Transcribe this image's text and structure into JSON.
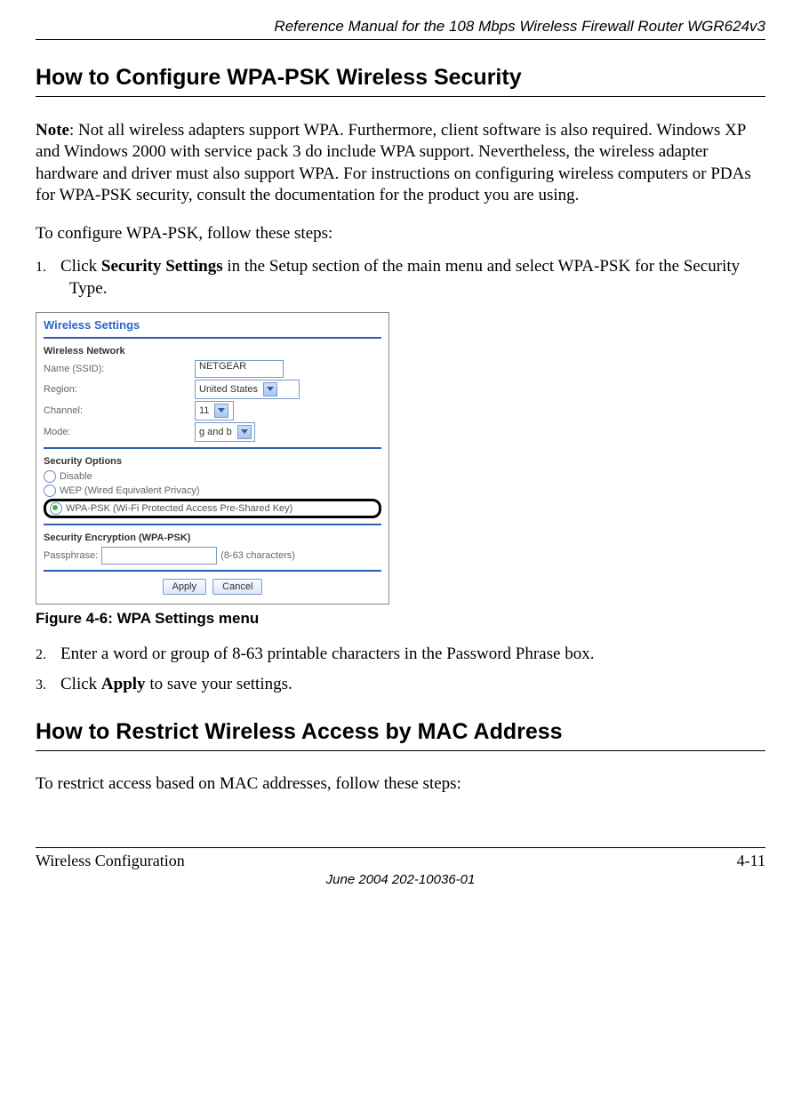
{
  "header": "Reference Manual for the 108 Mbps Wireless Firewall Router WGR624v3",
  "section1_title": "How to Configure WPA-PSK Wireless Security",
  "note_label": "Note",
  "note_body": ": Not all wireless adapters support WPA. Furthermore, client software is also required. Windows XP and Windows 2000 with service pack 3 do include WPA support. Nevertheless, the wireless adapter hardware and driver must also support WPA. For instructions on configuring wireless computers or PDAs for WPA-PSK security, consult the documentation for the product you are using.",
  "intro1": "To configure WPA-PSK, follow these steps:",
  "step1_prefix": "Click ",
  "step1_bold": "Security Settings",
  "step1_suffix": " in the Setup section of the main menu and select WPA-PSK for the Security Type.",
  "figure_caption": "Figure 4-6: WPA Settings menu",
  "step2": "Enter a word or group of 8-63 printable characters in the Password Phrase box.",
  "step3_prefix": "Click ",
  "step3_bold": "Apply",
  "step3_suffix": " to save your settings.",
  "section2_title": "How to Restrict Wireless Access by MAC Address",
  "intro2": "To restrict access based on MAC addresses, follow these steps:",
  "footer_left": "Wireless Configuration",
  "footer_right": "4-11",
  "footer_center": "June 2004 202-10036-01",
  "screenshot": {
    "title": "Wireless Settings",
    "wireless_network": "Wireless Network",
    "name_label": "Name (SSID):",
    "name_value": "NETGEAR",
    "region_label": "Region:",
    "region_value": "United States",
    "channel_label": "Channel:",
    "channel_value": "11",
    "mode_label": "Mode:",
    "mode_value": "g and b",
    "security_options": "Security Options",
    "opt_disable": "Disable",
    "opt_wep": "WEP (Wired Equivalent Privacy)",
    "opt_wpa": "WPA-PSK (Wi-Fi Protected Access Pre-Shared Key)",
    "encryption_header": "Security Encryption (WPA-PSK)",
    "pass_label": "Passphrase:",
    "pass_hint": "(8-63 characters)",
    "apply": "Apply",
    "cancel": "Cancel"
  }
}
